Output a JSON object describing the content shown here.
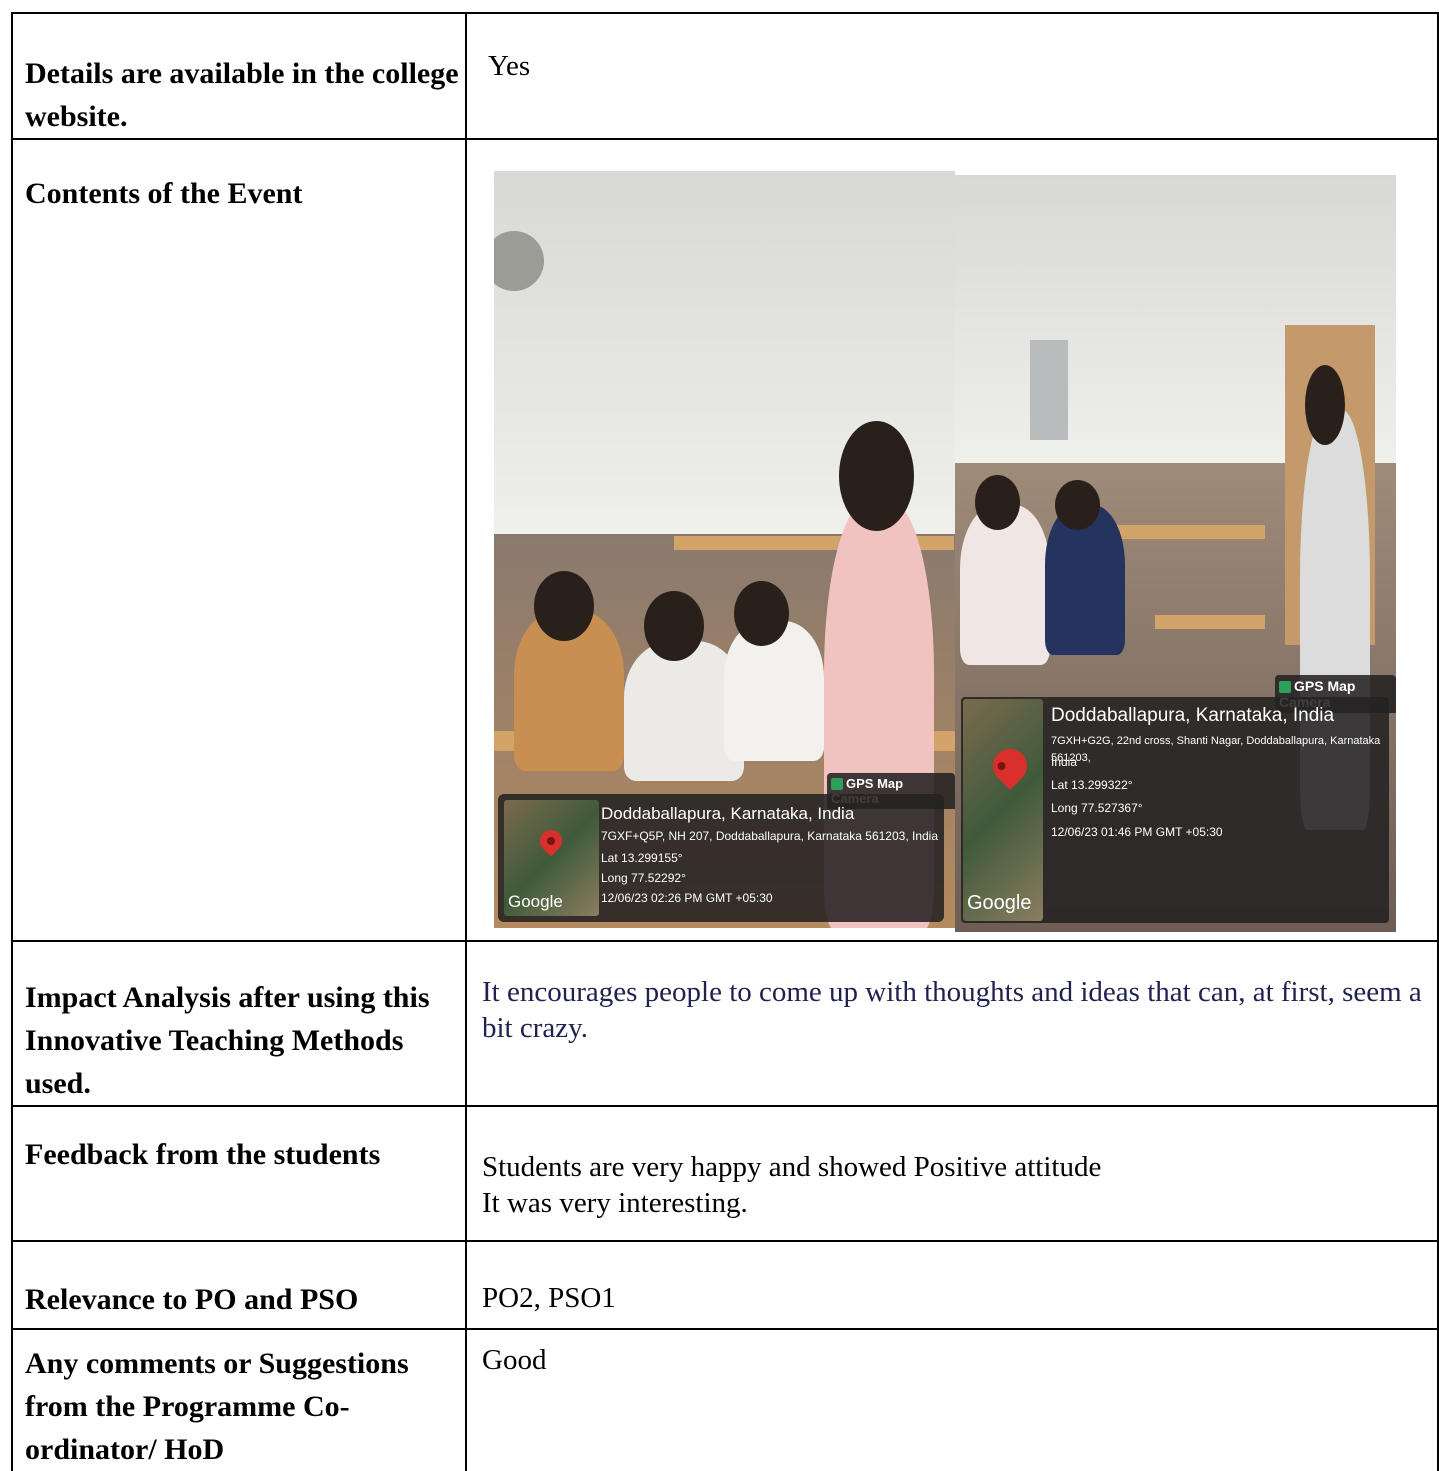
{
  "rows": [
    {
      "label": "Details are available in the college website.",
      "value": "Yes"
    },
    {
      "label": "Contents of the Event"
    },
    {
      "label": "Impact Analysis after using this Innovative Teaching Methods used.",
      "value": "It encourages people to come up with thoughts and ideas that can, at first, seem a bit crazy."
    },
    {
      "label": "Feedback from the students",
      "value_line1": "Students are very  happy and showed Positive attitude",
      "value_line2": "It was very interesting."
    },
    {
      "label": "Relevance to PO and PSO",
      "value": "PO2, PSO1"
    },
    {
      "label": "Any comments or Suggestions from the Programme Co-ordinator/ HoD",
      "value": "Good"
    }
  ],
  "photos": [
    {
      "badge": "GPS Map Camera",
      "map_logo": "Google",
      "place": "Doddaballapura, Karnataka, India",
      "address": "7GXF+Q5P, NH 207, Doddaballapura, Karnataka 561203, India",
      "lat": "Lat 13.299155°",
      "long": "Long 77.52292°",
      "timestamp": "12/06/23 02:26 PM GMT +05:30"
    },
    {
      "badge": "GPS Map Camera",
      "map_logo": "Google",
      "place": "Doddaballapura, Karnataka, India",
      "address_line1": "7GXH+G2G, 22nd cross, Shanti Nagar, Doddaballapura, Karnataka 561203,",
      "address_line2": "India",
      "lat": "Lat 13.299322°",
      "long": "Long 77.527367°",
      "timestamp": "12/06/23 01:46 PM GMT +05:30"
    }
  ]
}
